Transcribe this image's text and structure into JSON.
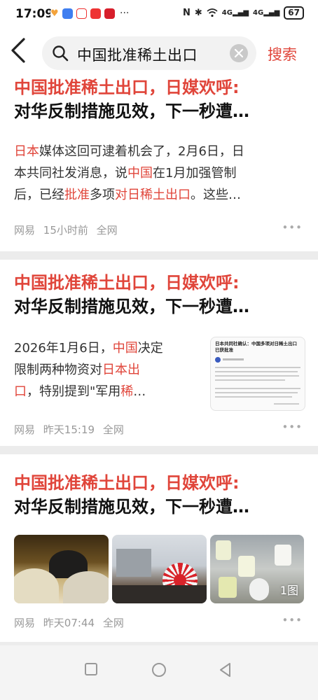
{
  "status": {
    "time": "17:09",
    "more": "···",
    "net1": "4G",
    "net2": "4G",
    "battery": "67"
  },
  "search": {
    "query": "中国批准稀土出口",
    "action": "搜索"
  },
  "results": [
    {
      "title_hl": "中国批准稀土出口，日媒欢呼:",
      "title_rest": "对华反制措施见效，下一秒遭…",
      "summary": [
        [
          {
            "t": "日本",
            "h": true
          },
          {
            "t": "媒体这回可逮着机会了，2月6日，日",
            "h": false
          }
        ],
        [
          {
            "t": "本共同社发消息，说",
            "h": false
          },
          {
            "t": "中国",
            "h": true
          },
          {
            "t": "在1月加强管制",
            "h": false
          }
        ],
        [
          {
            "t": "后，已经",
            "h": false
          },
          {
            "t": "批准",
            "h": true
          },
          {
            "t": "多项",
            "h": false
          },
          {
            "t": "对日稀土出口",
            "h": true
          },
          {
            "t": "。这些…",
            "h": false
          }
        ]
      ],
      "source": "网易",
      "time": "15小时前",
      "scope": "全网"
    },
    {
      "title_hl": "中国批准稀土出口，日媒欢呼:",
      "title_rest": "对华反制措施见效，下一秒遭…",
      "summary": [
        [
          {
            "t": "2026年1月6日，",
            "h": false
          },
          {
            "t": "中国",
            "h": true
          },
          {
            "t": "决定",
            "h": false
          }
        ],
        [
          {
            "t": "限制两种物资对",
            "h": false
          },
          {
            "t": "日本出",
            "h": true
          }
        ],
        [
          {
            "t": "口",
            "h": true
          },
          {
            "t": "，特别提到\"军用",
            "h": false
          },
          {
            "t": "稀",
            "h": true
          },
          {
            "t": "…",
            "h": false
          }
        ]
      ],
      "thumb_heading": "日本共同社确认：中国多项对日稀土出口已获批准",
      "source": "网易",
      "time": "昨天15:19",
      "scope": "全网"
    },
    {
      "title_hl": "中国批准稀土出口，日媒欢呼:",
      "title_rest": "对华反制措施见效，下一秒遭…",
      "image_badge": "1图",
      "source": "网易",
      "time": "昨天07:44",
      "scope": "全网"
    }
  ],
  "colors": {
    "accent": "#e0453a",
    "background": "#ececec"
  }
}
